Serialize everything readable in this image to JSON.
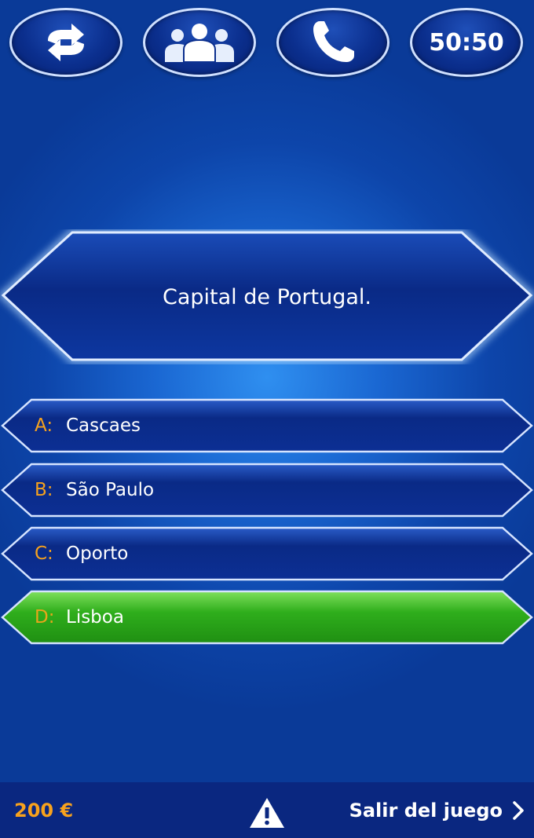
{
  "lifelines": {
    "switch_icon": "swap-arrows-icon",
    "audience_icon": "audience-people-icon",
    "phone_icon": "phone-icon",
    "fifty_label": "50:50"
  },
  "question": {
    "text": "Capital de Portugal."
  },
  "answers": [
    {
      "letter": "A:",
      "text": "Cascaes",
      "state": "normal"
    },
    {
      "letter": "B:",
      "text": "São Paulo",
      "state": "normal"
    },
    {
      "letter": "C:",
      "text": "Oporto",
      "state": "normal"
    },
    {
      "letter": "D:",
      "text": "Lisboa",
      "state": "correct"
    }
  ],
  "footer": {
    "prize": "200 €",
    "warning_icon": "warning-triangle-icon",
    "exit_label": "Salir del juego",
    "exit_icon": "chevron-right-icon"
  },
  "colors": {
    "background": "#1a67d2",
    "answer_fill": "#0b2f8e",
    "correct_fill": "#2fae1c",
    "letter": "#f7a21d",
    "border": "#cfe0ff",
    "footer_bg": "#0a2780"
  }
}
